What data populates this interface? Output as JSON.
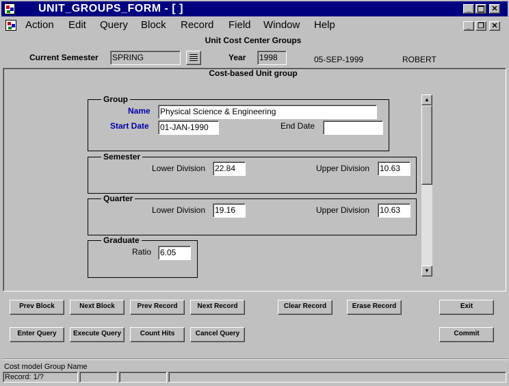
{
  "window": {
    "title": "UNIT_GROUPS_FORM - [ ]"
  },
  "menu": {
    "items": [
      "Action",
      "Edit",
      "Query",
      "Block",
      "Record",
      "Field",
      "Window",
      "Help"
    ]
  },
  "header": {
    "title": "Unit Cost Center Groups",
    "semester_label": "Current Semester",
    "semester_value": "SPRING",
    "year_label": "Year",
    "year_value": "1998",
    "date": "05-SEP-1999",
    "user": "ROBERT"
  },
  "block": {
    "title": "Cost-based Unit group",
    "group": {
      "title": "Group",
      "name_label": "Name",
      "name_value": "Physical Science & Engineering",
      "start_label": "Start Date",
      "start_value": "01-JAN-1990",
      "end_label": "End Date",
      "end_value": ""
    },
    "semester": {
      "title": "Semester",
      "lower_label": "Lower Division",
      "lower_value": "22.84",
      "upper_label": "Upper Division",
      "upper_value": "10.63"
    },
    "quarter": {
      "title": "Quarter",
      "lower_label": "Lower Division",
      "lower_value": "19.16",
      "upper_label": "Upper Division",
      "upper_value": "10.63"
    },
    "graduate": {
      "title": "Graduate",
      "ratio_label": "Ratio",
      "ratio_value": "6.05"
    }
  },
  "buttons": {
    "prev_block": "Prev Block",
    "next_block": "Next Block",
    "prev_record": "Prev Record",
    "next_record": "Next Record",
    "clear_record": "Clear Record",
    "erase_record": "Erase Record",
    "exit": "Exit",
    "enter_query": "Enter Query",
    "execute_query": "Execute Query",
    "count_hits": "Count Hits",
    "cancel_query": "Cancel Query",
    "commit": "Commit"
  },
  "status": {
    "hint": "Cost model Group Name",
    "record": "Record: 1/?"
  },
  "colors": {
    "titlebar": "#000080",
    "label_blue": "#0000a8",
    "face": "#c0c0c0"
  }
}
